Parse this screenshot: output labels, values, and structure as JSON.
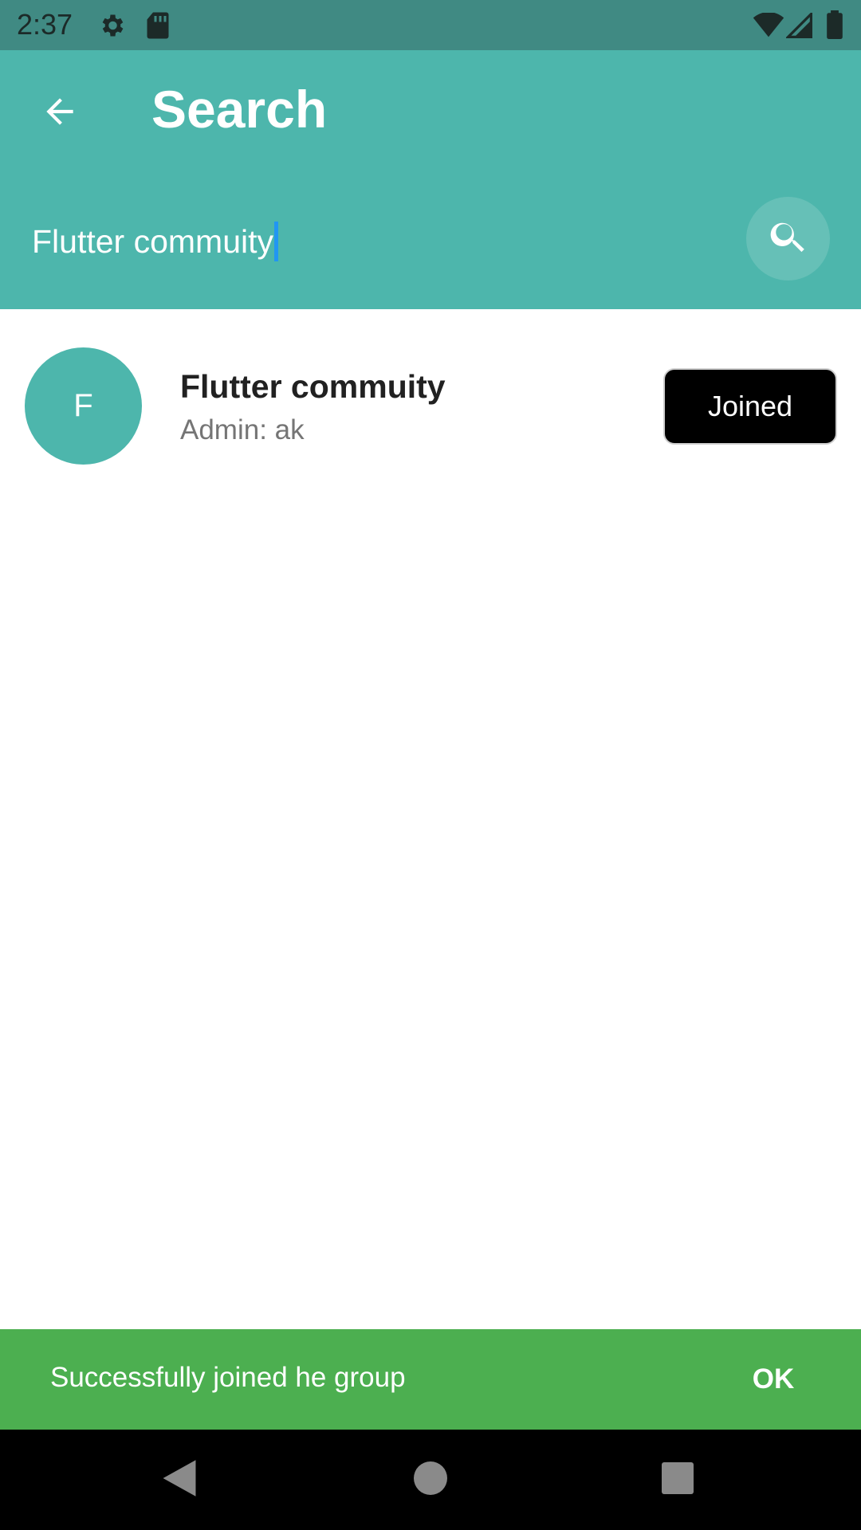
{
  "status_bar": {
    "time": "2:37",
    "icons": [
      "settings-icon",
      "sd-card-icon",
      "wifi-icon",
      "signal-icon",
      "battery-icon"
    ]
  },
  "app_bar": {
    "title": "Search",
    "back_icon": "arrow-back-icon",
    "background_color": "#4db6ac"
  },
  "search": {
    "value": "Flutter commuity",
    "button_icon": "search-icon"
  },
  "results": [
    {
      "avatar_letter": "F",
      "name": "Flutter commuity",
      "subtitle": "Admin: ak",
      "action_label": "Joined"
    }
  ],
  "snackbar": {
    "message": "Successfully joined he group",
    "action": "OK",
    "background_color": "#4caf50"
  },
  "nav_bar": {
    "buttons": [
      "back-triangle-icon",
      "home-circle-icon",
      "recents-square-icon"
    ]
  }
}
